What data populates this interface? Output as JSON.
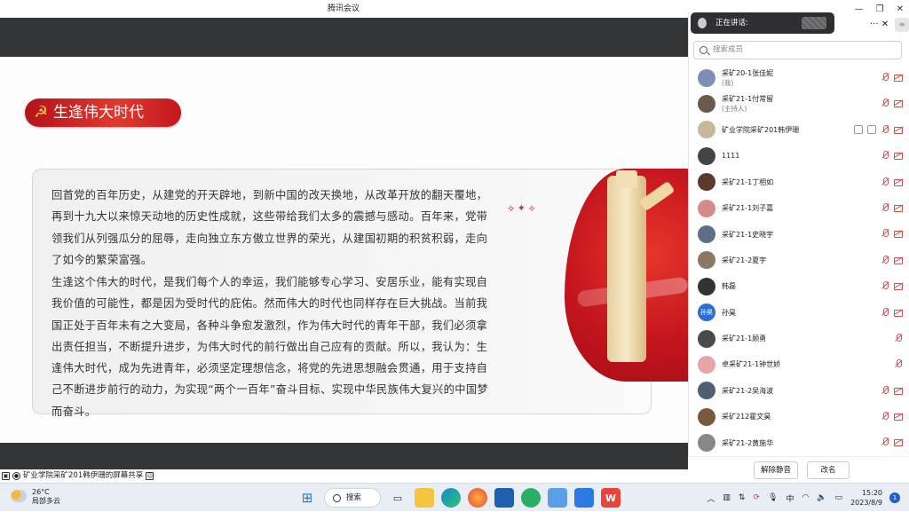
{
  "window": {
    "title": "腾讯会议",
    "controls": [
      "—",
      "❐",
      "✕"
    ]
  },
  "slide": {
    "banner": "生逢伟大时代",
    "para1": "回首党的百年历史，从建党的开天辟地，到新中国的改天换地，从改革开放的翻天覆地，再到十九大以来惊天动地的历史性成就，这些带给我们太多的震撼与感动。百年来，党带领我们从列强瓜分的屈辱，走向独立东方傲立世界的荣光，从建国初期的积贫积弱，走向了如今的繁荣富强。",
    "para2": "生逢这个伟大的时代，是我们每个人的幸运，我们能够专心学习、安居乐业，能有实现自我价值的可能性，都是因为受时代的庇佑。然而伟大的时代也同样存在巨大挑战。当前我国正处于百年未有之大变局，各种斗争愈发激烈，作为伟大时代的青年干部，我们必须拿出责任担当，不断提升进步，为伟大时代的前行做出自己应有的贡献。所以，我认为：生逢伟大时代，成为先进青年，必须坚定理想信念，将党的先进思想融会贯通，用于支持自己不断进步前行的动力，为实现“两个一百年”奋斗目标、实现中华民族伟大复兴的中国梦而奋斗。"
  },
  "share_bar": {
    "label": "矿业学院采矿201韩伊珊的屏幕共享"
  },
  "panel": {
    "speaking_label": "正在讲话:",
    "tools": "···  ✕",
    "search_placeholder": "搜索成员",
    "members": [
      {
        "name": "采矿20-1张佳妮",
        "sub": "(我)",
        "avatar_color": "#7d8fb3",
        "extra": 0
      },
      {
        "name": "采矿21-1付常留",
        "sub": "(主持人)",
        "avatar_color": "#6b5a4e",
        "extra": 0
      },
      {
        "name": "矿业学院采矿201韩伊珊",
        "sub": "",
        "avatar_color": "#c8b89a",
        "extra": 2
      },
      {
        "name": "1111",
        "sub": "",
        "avatar_color": "#444",
        "extra": 0
      },
      {
        "name": "采矿21-1丁相如",
        "sub": "",
        "avatar_color": "#5a3a2a",
        "extra": 0
      },
      {
        "name": "采矿21-1刘子嘉",
        "sub": "",
        "avatar_color": "#d68a8a",
        "extra": 0
      },
      {
        "name": "采矿21-1史晓宇",
        "sub": "",
        "avatar_color": "#5c6e88",
        "extra": 0
      },
      {
        "name": "采矿21-2夏宇",
        "sub": "",
        "avatar_color": "#8a7766",
        "extra": 0
      },
      {
        "name": "韩磊",
        "sub": "",
        "avatar_color": "#333",
        "extra": 0
      },
      {
        "name": "孙昊",
        "sub": "",
        "avatar_color": "#2a6fd6",
        "extra": 0,
        "avatar_text": "孙昊"
      },
      {
        "name": "采矿21-1顾勇",
        "sub": "",
        "avatar_color": "#4a4a4a",
        "extra": 0,
        "no_cam": true
      },
      {
        "name": "卓采矿21-1钟世娇",
        "sub": "",
        "avatar_color": "#e7a4a6",
        "extra": 0,
        "no_cam": true
      },
      {
        "name": "采矿21-2吴海波",
        "sub": "",
        "avatar_color": "#4f5f72",
        "extra": 0
      },
      {
        "name": "采矿212霍文昊",
        "sub": "",
        "avatar_color": "#7a5a3c",
        "extra": 0
      },
      {
        "name": "采矿21-2黄施华",
        "sub": "",
        "avatar_color": "#888",
        "extra": 0
      }
    ],
    "unmute_button": "解除静音",
    "rename_button": "改名"
  },
  "taskbar": {
    "temperature": "26°C",
    "weather": "局部多云",
    "search_label": "搜索",
    "ime": "中",
    "time": "15:20",
    "date": "2023/8/9",
    "notifications": "1"
  }
}
